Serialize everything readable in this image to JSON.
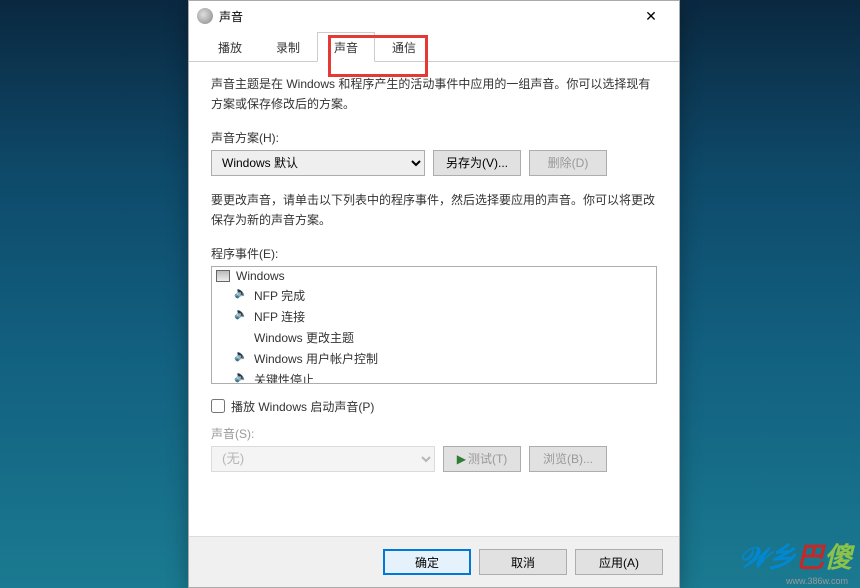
{
  "titlebar": {
    "title": "声音"
  },
  "tabs": {
    "playback": "播放",
    "recording": "录制",
    "sounds": "声音",
    "communications": "通信"
  },
  "content": {
    "intro": "声音主题是在 Windows 和程序产生的活动事件中应用的一组声音。你可以选择现有方案或保存修改后的方案。",
    "scheme_label": "声音方案(H):",
    "scheme_value": "Windows 默认",
    "save_as_btn": "另存为(V)...",
    "delete_btn": "删除(D)",
    "events_intro": "要更改声音，请单击以下列表中的程序事件，然后选择要应用的声音。你可以将更改保存为新的声音方案。",
    "events_label": "程序事件(E):",
    "events": [
      {
        "label": "Windows",
        "type": "root"
      },
      {
        "label": "NFP 完成",
        "type": "sound"
      },
      {
        "label": "NFP 连接",
        "type": "sound"
      },
      {
        "label": "Windows 更改主题",
        "type": "none"
      },
      {
        "label": "Windows 用户帐户控制",
        "type": "sound"
      },
      {
        "label": "关键性停止",
        "type": "sound"
      }
    ],
    "startup_checkbox": "播放 Windows 启动声音(P)",
    "sound_label": "声音(S):",
    "sound_value": "(无)",
    "test_btn": "测试(T)",
    "browse_btn": "浏览(B)..."
  },
  "footer": {
    "ok": "确定",
    "cancel": "取消",
    "apply": "应用(A)"
  },
  "watermark": {
    "chars": [
      "乡",
      "巴",
      "傻"
    ],
    "url": "www.386w.com"
  }
}
